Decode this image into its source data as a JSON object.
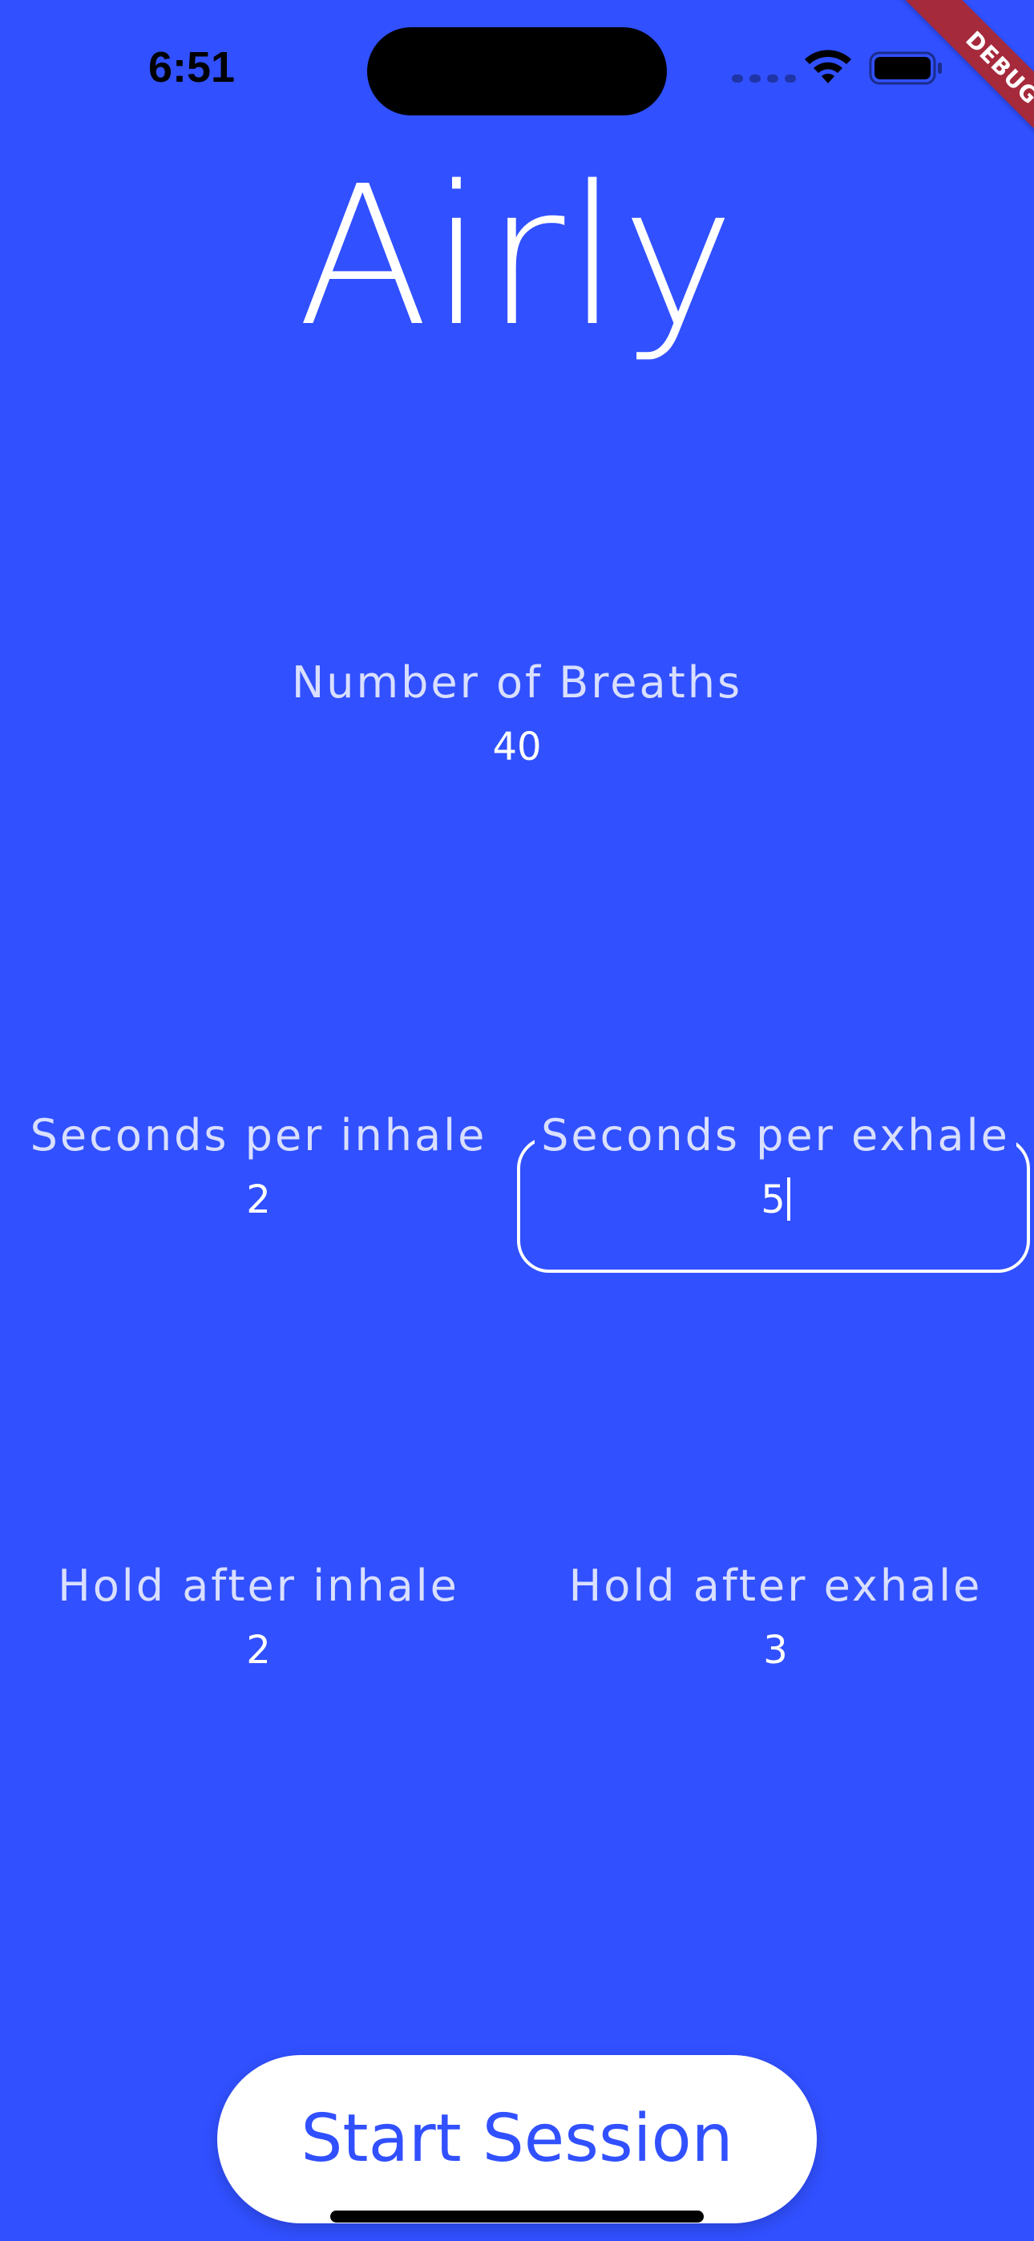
{
  "colors": {
    "background": "#3150ff",
    "text": "#ffffff",
    "debug_banner": "#a52a3c"
  },
  "status_bar": {
    "time": "6:51",
    "icons": [
      "cellular-signal-icon",
      "wifi-icon",
      "battery-icon"
    ]
  },
  "debug_banner": "DEBUG",
  "app": {
    "title": "Airly"
  },
  "fields": {
    "breaths": {
      "label": "Number of Breaths",
      "value": "40"
    },
    "inhale": {
      "label": "Seconds per inhale",
      "value": "2"
    },
    "exhale": {
      "label": "Seconds per exhale",
      "value": "5"
    },
    "hold_inhale": {
      "label": "Hold after inhale",
      "value": "2"
    },
    "hold_exhale": {
      "label": "Hold after exhale",
      "value": "3"
    }
  },
  "start_button": {
    "label": "Start Session"
  }
}
